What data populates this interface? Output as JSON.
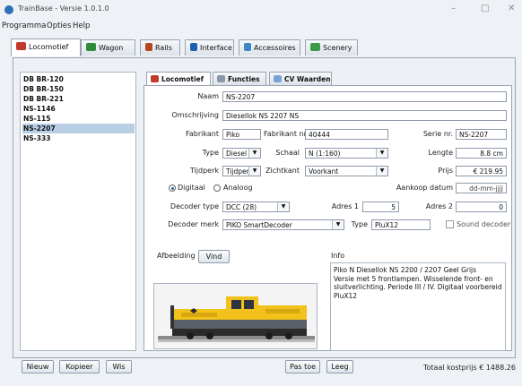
{
  "window": {
    "title": "TrainBase - Versie 1.0.1.0",
    "minimize": "–",
    "maximize": "□",
    "close": "✕"
  },
  "menu": [
    "Programma",
    "Opties",
    "Help"
  ],
  "main_tabs": [
    "Locomotief",
    "Wagon",
    "Rails",
    "Interface",
    "Accessoires",
    "Scenery"
  ],
  "loco_list": [
    "DB BR-120",
    "DB BR-150",
    "DB BR-221",
    "NS-1146",
    "NS-115",
    "NS-2207",
    "NS-333"
  ],
  "selected_loco": "NS-2207",
  "sub_tabs": [
    "Locomotief",
    "Functies",
    "CV Waarden"
  ],
  "form": {
    "naam_label": "Naam",
    "naam": "NS-2207",
    "omschrijving_label": "Omschrijving",
    "omschrijving": "Diesellok NS 2207 NS",
    "fabrikant_label": "Fabrikant",
    "fabrikant": "Piko",
    "fabrikant_nr_label": "Fabrikant nr.",
    "fabrikant_nr": "40444",
    "serie_nr_label": "Serie nr.",
    "serie_nr": "NS-2207",
    "type_label": "Type",
    "type": "Diesel",
    "schaal_label": "Schaal",
    "schaal": "N (1:160)",
    "lengte_label": "Lengte",
    "lengte": "8.8 cm",
    "tijdperk_label": "Tijdperk",
    "tijdperk": "Tijdperk V",
    "zichtkant_label": "Zichtkant",
    "zichtkant": "Voorkant",
    "prijs_label": "Prijs",
    "prijs": "€ 219.95",
    "digitaal_label": "Digitaal",
    "analoog_label": "Analoog",
    "aankoop_label": "Aankoop datum",
    "aankoop": "dd-mm-jjjj",
    "decoder_type_label": "Decoder type",
    "decoder_type": "DCC (28)",
    "adres1_label": "Adres 1",
    "adres1": "5",
    "adres2_label": "Adres 2",
    "adres2": "0",
    "decoder_merk_label": "Decoder merk",
    "decoder_merk": "PIKO SmartDecoder",
    "decoder_model_label": "Type",
    "decoder_model": "PluX12",
    "sound_label": "Sound decoder",
    "afbeelding_label": "Afbeelding",
    "vind_label": "Vind",
    "info_label": "Info",
    "info_text": "Piko N Diesellok NS 2200 / 2207 Geel Grijs\nVersie met 5 frontlampen. Wisselende front- en\nsluitverlichting. Periode III / IV. Digitaal voorbereid\nPluX12"
  },
  "bottom": {
    "nieuw": "Nieuw",
    "kopieer": "Kopieer",
    "wis": "Wis",
    "pas_toe": "Pas toe",
    "leeg": "Leeg",
    "totaal": "Totaal kostprijs € 1488.26"
  },
  "colors": {
    "accent": "#2a5ea8",
    "selection": "#b8cfe6",
    "loco_yellow": "#f2c21b"
  }
}
